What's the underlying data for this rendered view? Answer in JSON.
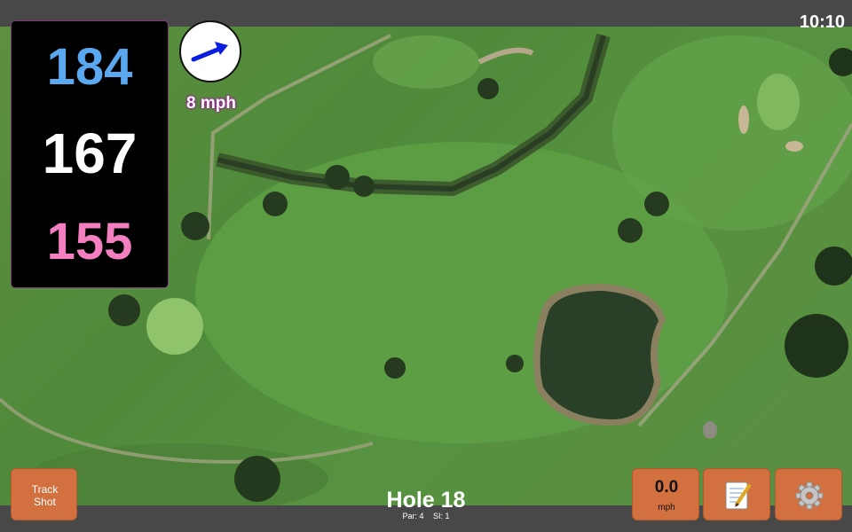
{
  "status_bar": {
    "time": "10:10"
  },
  "distances": {
    "back": "184",
    "middle": "167",
    "front": "155"
  },
  "wind": {
    "speed_label": "8 mph",
    "direction_icon": "arrow-up-right-icon"
  },
  "hole": {
    "title": "Hole 18",
    "par": "Par: 4",
    "stroke_index": "SI: 1"
  },
  "buttons": {
    "track_shot": "Track Shot",
    "speed_value": "0.0",
    "speed_unit": "mph",
    "notes_icon": "notepad-icon",
    "settings_icon": "gear-icon"
  },
  "colors": {
    "back": "#5aa8f0",
    "middle": "#ffffff",
    "front": "#f37fc0",
    "button": "#d2703f"
  }
}
